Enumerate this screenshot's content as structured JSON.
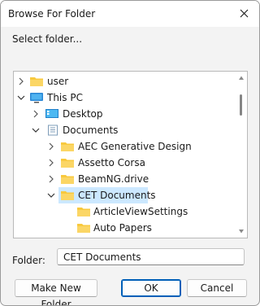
{
  "window": {
    "title": "Browse For Folder"
  },
  "instructions": "Select folder...",
  "tree": {
    "items": [
      {
        "label": "user",
        "icon": "folder-icon",
        "expanded": false
      },
      {
        "label": "This PC",
        "icon": "computer-icon",
        "expanded": true
      },
      {
        "label": "Desktop",
        "icon": "desktop-icon",
        "expanded": false
      },
      {
        "label": "Documents",
        "icon": "documents-icon",
        "expanded": true
      },
      {
        "label": "AEC Generative Design",
        "icon": "folder-icon",
        "expanded": false
      },
      {
        "label": "Assetto Corsa",
        "icon": "folder-icon",
        "expanded": false
      },
      {
        "label": "BeamNG.drive",
        "icon": "folder-icon",
        "expanded": false
      },
      {
        "label": "CET Documents",
        "icon": "folder-icon",
        "expanded": true,
        "selected": true
      },
      {
        "label": "ArticleViewSettings",
        "icon": "folder-icon"
      },
      {
        "label": "Auto Papers",
        "icon": "folder-icon"
      }
    ]
  },
  "folder_field": {
    "label": "Folder:",
    "value": "CET Documents"
  },
  "buttons": {
    "make_new_folder": "Make New Folder",
    "ok": "OK",
    "cancel": "Cancel"
  },
  "colors": {
    "selection": "#cce8ff",
    "folder_yellow": "#f8c93e",
    "accent": "#005fb8"
  }
}
